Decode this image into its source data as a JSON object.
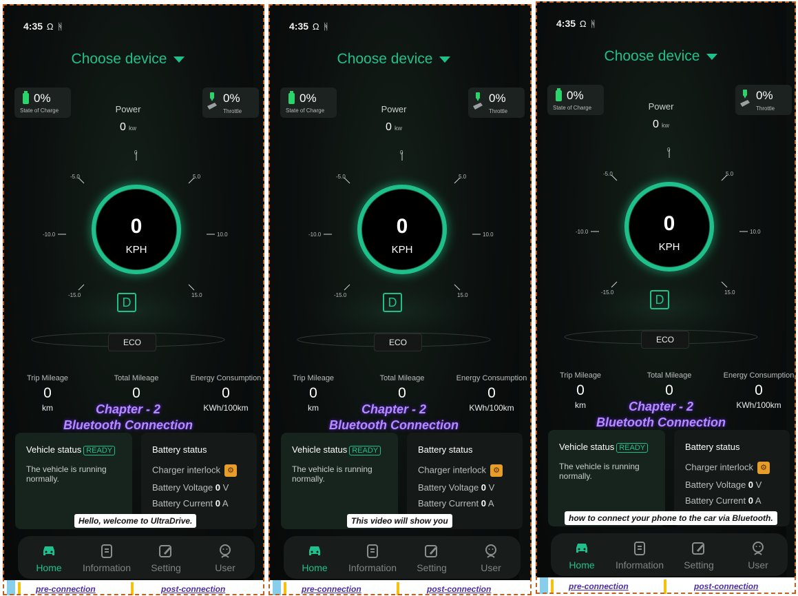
{
  "colors": {
    "accent": "#20c08c",
    "chapter": "#b58cff",
    "frame": "#c0601e",
    "battery": "#2bd36b",
    "interlock": "#e69d2a"
  },
  "panels": [
    {
      "status_bar": {
        "time": "4:35",
        "icons": "headphones-icon bluetooth-icon"
      },
      "header": {
        "title": "Choose device"
      },
      "soc": {
        "value": "0%",
        "label": "State of Charge"
      },
      "throttle": {
        "value": "0%",
        "label": "Throttle"
      },
      "power": {
        "label": "Power",
        "value": "0",
        "unit": "kw"
      },
      "gauge": {
        "speed": "0",
        "unit": "KPH",
        "gear": "D",
        "mode": "ECO",
        "ticks": {
          "top": "0",
          "ul": "-5.0",
          "ur": "5.0",
          "ml": "-10.0",
          "mr": "10.0",
          "ll": "-15.0",
          "lr": "15.0"
        }
      },
      "stats": {
        "trip_label": "Trip Mileage",
        "trip_value": "0",
        "trip_unit": "km",
        "total_label": "Total Mileage",
        "total_value": "0",
        "energy_label": "Energy Consumption",
        "energy_value": "0",
        "energy_unit": "KWh/100km"
      },
      "overlay": {
        "chapter": "Chapter - 2",
        "subtitle": "Bluetooth Connection"
      },
      "vehicle": {
        "title": "Vehicle status",
        "badge": "READY",
        "desc": "The vehicle is running normally."
      },
      "battery": {
        "title": "Battery status",
        "interlock": "Charger interlock",
        "voltage_label": "Battery Voltage",
        "voltage_value": "0",
        "voltage_unit": "V",
        "current_label": "Battery Current",
        "current_value": "0",
        "current_unit": "A"
      },
      "caption": "Hello, welcome to UltraDrive.",
      "nav": {
        "home": "Home",
        "information": "Information",
        "setting": "Setting",
        "user": "User"
      },
      "strip": {
        "pre": "pre-connection",
        "post": "post-connection"
      }
    },
    {
      "status_bar": {
        "time": "4:35",
        "icons": "headphones-icon bluetooth-icon"
      },
      "header": {
        "title": "Choose device"
      },
      "soc": {
        "value": "0%",
        "label": "State of Charge"
      },
      "throttle": {
        "value": "0%",
        "label": "Throttle"
      },
      "power": {
        "label": "Power",
        "value": "0",
        "unit": "kw"
      },
      "gauge": {
        "speed": "0",
        "unit": "KPH",
        "gear": "D",
        "mode": "ECO",
        "ticks": {
          "top": "0",
          "ul": "-5.0",
          "ur": "5.0",
          "ml": "-10.0",
          "mr": "10.0",
          "ll": "-15.0",
          "lr": "15.0"
        }
      },
      "stats": {
        "trip_label": "Trip Mileage",
        "trip_value": "0",
        "trip_unit": "km",
        "total_label": "Total Mileage",
        "total_value": "0",
        "energy_label": "Energy Consumption",
        "energy_value": "0",
        "energy_unit": "KWh/100km"
      },
      "overlay": {
        "chapter": "Chapter - 2",
        "subtitle": "Bluetooth Connection"
      },
      "vehicle": {
        "title": "Vehicle status",
        "badge": "READY",
        "desc": "The vehicle is running normally."
      },
      "battery": {
        "title": "Battery status",
        "interlock": "Charger interlock",
        "voltage_label": "Battery Voltage",
        "voltage_value": "0",
        "voltage_unit": "V",
        "current_label": "Battery Current",
        "current_value": "0",
        "current_unit": "A"
      },
      "caption": "This video will show you",
      "nav": {
        "home": "Home",
        "information": "Information",
        "setting": "Setting",
        "user": "User"
      },
      "strip": {
        "pre": "pre-connection",
        "post": "post-connection"
      }
    },
    {
      "status_bar": {
        "time": "4:35",
        "icons": "headphones-icon bluetooth-icon"
      },
      "header": {
        "title": "Choose device"
      },
      "soc": {
        "value": "0%",
        "label": "State of Charge"
      },
      "throttle": {
        "value": "0%",
        "label": "Throttle"
      },
      "power": {
        "label": "Power",
        "value": "0",
        "unit": "kw"
      },
      "gauge": {
        "speed": "0",
        "unit": "KPH",
        "gear": "D",
        "mode": "ECO",
        "ticks": {
          "top": "0",
          "ul": "-5.0",
          "ur": "5.0",
          "ml": "-10.0",
          "mr": "10.0",
          "ll": "-15.0",
          "lr": "15.0"
        }
      },
      "stats": {
        "trip_label": "Trip Mileage",
        "trip_value": "0",
        "trip_unit": "km",
        "total_label": "Total Mileage",
        "total_value": "0",
        "energy_label": "Energy Consumption",
        "energy_value": "0",
        "energy_unit": "KWh/100km"
      },
      "overlay": {
        "chapter": "Chapter - 2",
        "subtitle": "Bluetooth Connection"
      },
      "vehicle": {
        "title": "Vehicle status",
        "badge": "READY",
        "desc": "The vehicle is running normally."
      },
      "battery": {
        "title": "Battery status",
        "interlock": "Charger interlock",
        "voltage_label": "Battery Voltage",
        "voltage_value": "0",
        "voltage_unit": "V",
        "current_label": "Battery Current",
        "current_value": "0",
        "current_unit": "A"
      },
      "caption": "how to connect your phone to the car via Bluetooth.",
      "nav": {
        "home": "Home",
        "information": "Information",
        "setting": "Setting",
        "user": "User"
      },
      "strip": {
        "pre": "pre-connection",
        "post": "post-connection"
      }
    }
  ]
}
